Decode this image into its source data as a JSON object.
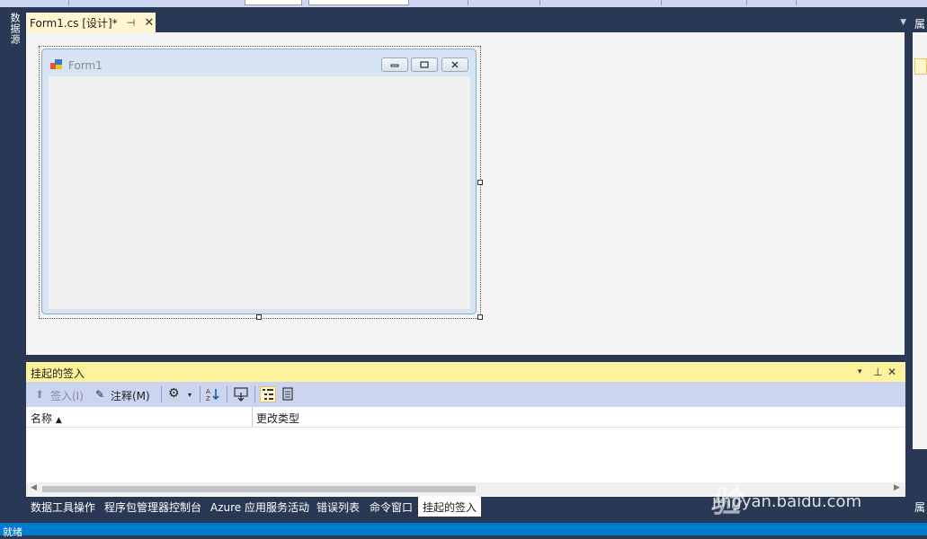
{
  "left_strip": {
    "tab_label": "数据源"
  },
  "doc_tab": {
    "title": "Form1.cs [设计]*",
    "pin_glyph": "⊣",
    "close_glyph": "✕"
  },
  "form": {
    "title": "Form1"
  },
  "right_strip": {
    "label_top": "属",
    "label_bottom": "属"
  },
  "tool_window": {
    "title": "挂起的签入",
    "menu_glyph": "▾",
    "pin_glyph": "⊥",
    "close_glyph": "✕",
    "toolbar": {
      "checkin_label": "签入(I)",
      "comment_label": "注释(M)"
    },
    "columns": {
      "name": "名称",
      "change_type": "更改类型"
    }
  },
  "bottom_tabs": [
    "数据工具操作",
    "程序包管理器控制台",
    "Azure 应用服务活动",
    "错误列表",
    "命令窗口",
    "挂起的签入"
  ],
  "watermark": {
    "logo": "Bai du 经验",
    "url": "jingyan.baidu.com"
  },
  "status": {
    "text": "就绪"
  },
  "colors": {
    "chrome": "#293955",
    "active_tab": "#fff6cf",
    "tool_header": "#fff29d",
    "status": "#007acc"
  }
}
